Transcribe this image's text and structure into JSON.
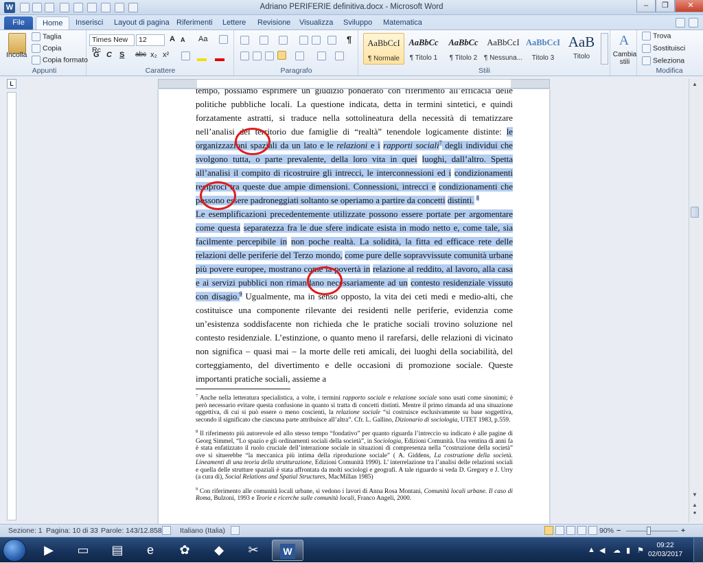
{
  "window": {
    "title": "Adriano PERIFERIE definitiva.docx - Microsoft Word",
    "minimize": "–",
    "maximize": "❐",
    "close": "✕"
  },
  "tabs": [
    "File",
    "Home",
    "Inserisci",
    "Layout di pagina",
    "Riferimenti",
    "Lettere",
    "Revisione",
    "Visualizza",
    "Sviluppo",
    "Matematica"
  ],
  "clipboard": {
    "paste": "Incolla",
    "cut": "Taglia",
    "copy": "Copia",
    "format_painter": "Copia formato",
    "label": "Appunti"
  },
  "font": {
    "family": "Times New Rc",
    "size": "12",
    "grow": "A",
    "shrink": "A",
    "case": "Aa",
    "bold": "G",
    "italic": "C",
    "underline": "S",
    "strike": "abc",
    "subscript": "x₂",
    "superscript": "x²",
    "label": "Carattere"
  },
  "paragraph": {
    "label": "Paragrafo",
    "pilcrow": "¶"
  },
  "styles": {
    "label": "Stili",
    "items": [
      {
        "sample": "AaBbCcI",
        "name": "¶ Normale"
      },
      {
        "sample": "AaBbCc",
        "name": "¶ Titolo 1"
      },
      {
        "sample": "AaBbCc",
        "name": "¶ Titolo 2"
      },
      {
        "sample": "AaBbCcI",
        "name": "¶ Nessuna..."
      },
      {
        "sample": "AaBbCcI",
        "name": "Titolo 3"
      },
      {
        "sample": "AaB",
        "name": "Titolo"
      }
    ],
    "change": "Cambia stili"
  },
  "editing": {
    "find": "Trova",
    "replace": "Sostituisci",
    "select": "Seleziona",
    "label": "Modifica"
  },
  "document": {
    "p1_lines": [
      "tempo, possiamo esprimere un giudizio ponderato con riferimento all’efficacia delle politiche",
      "pubbliche locali. La questione indicata, detta in termini sintetici, e quindi forzatamente astratti, si",
      "traduce nella sottolineatura della necessità di tematizzare nell’analisi del territorio due famiglie di"
    ],
    "p1_plain_4": "“realtà” tenendole logicamente distinte: ",
    "p1_hl_4a": "le organizzazioni spaziali da un lato e le ",
    "p1_hl_4b": "relazioni",
    "p1_hl_4c": " e i",
    "p1_hl_5a": "rapporti sociali",
    "p1_fn7": "7",
    "p1_hl_5b": " degli individui che svolgono tutta, o parte prevalente, della loro vita in quei",
    "p1_hl_lines": [
      "luoghi, dall’altro. Spetta all’analisi il compito di ricostruire gli intrecci, le interconnessioni ed i",
      "condizionamenti reciproci tra queste due ampie dimensioni. Connessioni, intrecci e",
      "condizionamenti che possono essere padroneggiati soltanto se operiamo a partire da concetti"
    ],
    "p1_hl_last": "distinti.",
    "p1_fn8": "8",
    "p2_hl_lines": [
      "Le esemplificazioni precedentemente utilizzate possono essere portate per argomentare come questa",
      "separatezza fra le due sfere indicate esista in modo netto e, come tale, sia facilmente percepibile in",
      "non poche realtà. La solidità, la fitta ed efficace rete delle relazioni delle periferie del Terzo mondo,",
      "come pure delle sopravvissute comunità urbane più povere europee, mostrano come la povertà in",
      "relazione al reddito, al lavoro, alla casa e ai servizi pubblici non rimandano necessariamente ad un"
    ],
    "p2_hl_last": "contesto residenziale vissuto con disagio.",
    "p2_fn9": "9",
    "p2_plain_first": " Ugualmente, ma in senso opposto, la vita dei ceti medi e",
    "p2_plain_lines": [
      "medio-alti, che costituisce una componente rilevante dei residenti nelle periferie, evidenzia come",
      "un’esistenza soddisfacente non richieda che le pratiche sociali trovino soluzione nel contesto",
      "residenziale. L’estinzione, o quanto meno il rarefarsi, delle relazioni di vicinato non significa –",
      "quasi mai – la morte delle reti amicali, dei luoghi della sociabilità, del corteggiamento, del",
      "divertimento e delle occasioni di promozione sociale. Queste importanti pratiche sociali, assieme a"
    ]
  },
  "footnotes": {
    "fn7": {
      "num": "7",
      "a": " Anche nella letteratura specialistica, a volte, i termini ",
      "b": "rapporto sociale",
      "c": " e ",
      "d": "relazione sociale",
      "e": " sono usati come sinonimi; è però necessario evitare questa confusione in quanto si tratta di concetti distinti. Mentre il primo rimanda ad una situazione oggettiva, di cui si può essere o meno coscienti, la ",
      "f": "relazione sociale",
      "g": " “si costruisce esclusivamente su base soggettiva, secondo il significato che ciascuna parte attribuisce all’altra”. Cfr. L. Gallino, ",
      "h": "Dizionario di sociologia",
      "i": ", UTET 1983, p.559."
    },
    "fn8": {
      "num": "8",
      "a": " Il riferimento più autorevole ed allo stesso tempo “fondativo” per quanto riguarda l’intreccio su indicato è alle pagine di Georg Simmel, “Lo spazio e gli ordinamenti sociali della società”, in ",
      "b": "Sociologia,",
      "c": " Edizioni Comunità. Una ventina di anni fa è stata enfatizzato il ruolo cruciale dell’interazione sociale in situazioni di compresenza nella “costruzione della società” ove si situerebbe “la meccanica più intima della riproduzione sociale” ( A. Giddens, ",
      "d": "La costruzione della società. Lineamenti di una teoria della strutturazione,",
      "e": " Edizioni Comunità 1990). L’ interrelazione tra l’analisi delle relazioni sociali e quella delle strutture spaziali è stata affrontata da molti sociologi e geografi. A tale riguardo si veda D. Gregory e J. Urry (a cura di), ",
      "f": "Social Relations and Spatial Structures",
      "g": ", MacMillan 1985)"
    },
    "fn9": {
      "num": "9",
      "a": " Con riferimento alle comunità locali urbane, si vedono i lavori di Anna Rosa Montani, ",
      "b": "Comunità locali urbane. Il caso di Roma",
      "c": ", Bulzoni, 1993 e ",
      "d": "Teorie e ricerche sulle comunità locali",
      "e": ", Franco Angeli, 2000."
    }
  },
  "status": {
    "section": "Sezione: 1",
    "page": "Pagina: 10 di 33",
    "words": "Parole: 143/12.858",
    "language": "Italiano (Italia)",
    "zoom": "90%",
    "zoom_out": "−",
    "zoom_in": "+"
  },
  "taskbar": {
    "time": "09:22",
    "date": "02/03/2017",
    "word_app": "W"
  },
  "colors": {
    "selection": "#b3cdf1",
    "annotation_circle": "#e01b1b",
    "file_tab": "#2a58a6"
  }
}
